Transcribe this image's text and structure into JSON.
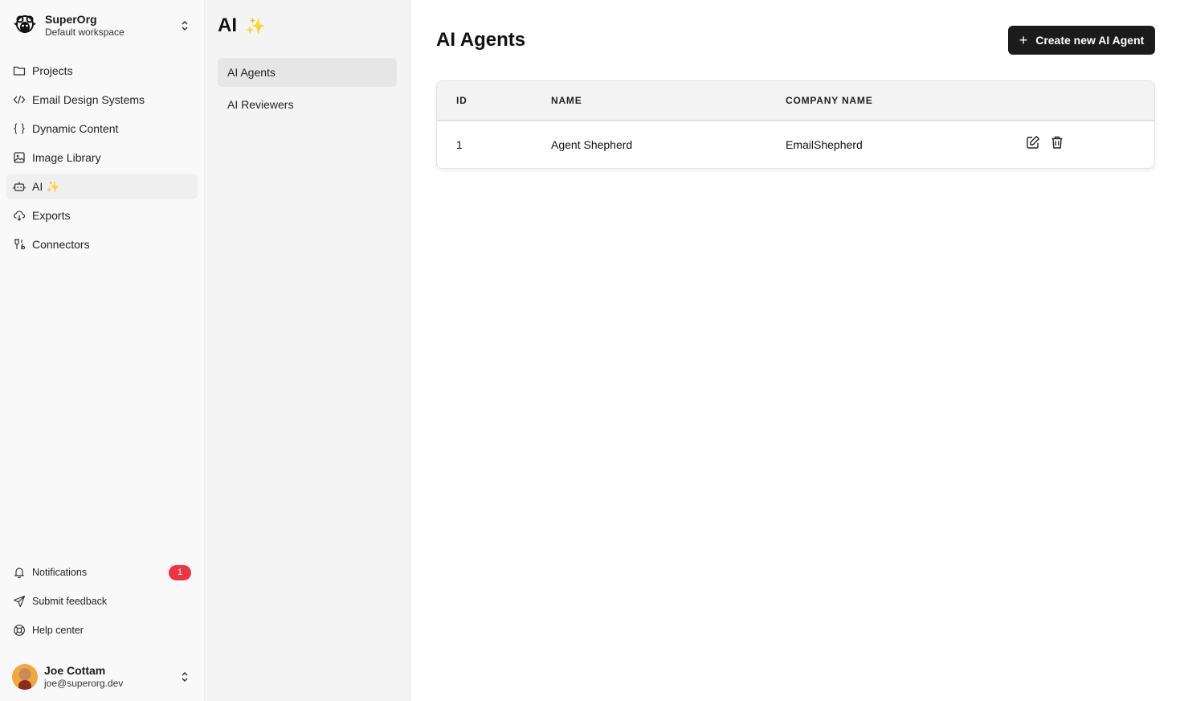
{
  "org": {
    "name": "SuperOrg",
    "workspace": "Default workspace"
  },
  "nav": {
    "items": [
      {
        "label": "Projects"
      },
      {
        "label": "Email Design Systems"
      },
      {
        "label": "Dynamic Content"
      },
      {
        "label": "Image Library"
      },
      {
        "label": "AI",
        "sparkle": "✨"
      },
      {
        "label": "Exports"
      },
      {
        "label": "Connectors"
      }
    ]
  },
  "bottom_nav": {
    "notifications": {
      "label": "Notifications",
      "count": "1"
    },
    "feedback": {
      "label": "Submit feedback"
    },
    "help": {
      "label": "Help center"
    }
  },
  "user": {
    "name": "Joe Cottam",
    "email": "joe@superorg.dev"
  },
  "subpanel": {
    "title": "AI",
    "sparkle": "✨",
    "items": [
      {
        "label": "AI Agents"
      },
      {
        "label": "AI Reviewers"
      }
    ]
  },
  "main": {
    "title": "AI Agents",
    "create_button": "Create new AI Agent",
    "table": {
      "columns": [
        "ID",
        "NAME",
        "COMPANY NAME"
      ],
      "rows": [
        {
          "id": "1",
          "name": "Agent Shepherd",
          "company": "EmailShepherd"
        }
      ]
    }
  },
  "colors": {
    "accent": "#1b1b1b",
    "badge": "#ef3340",
    "sparkle": "#f5c645"
  }
}
